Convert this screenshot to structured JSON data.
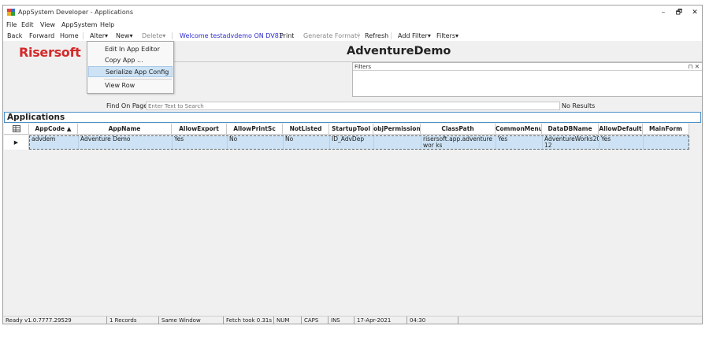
{
  "window": {
    "title": "AppSystem Developer - Applications",
    "minimize": "–",
    "restore": "🗗",
    "close": "✕",
    "app_icon": "app-icon"
  },
  "menu": {
    "file": "File",
    "edit": "Edit",
    "view": "View",
    "appsystem": "AppSystem",
    "help": "Help"
  },
  "toolbar": {
    "back": "Back",
    "forward": "Forward",
    "home": "Home",
    "alter": "Alter▾",
    "new": "New▾",
    "delete": "Delete▾",
    "welcome": "Welcome testadvdemo ON DV81",
    "print": "Print",
    "generate_format": "Generate Format▾",
    "refresh": "Refresh",
    "add_filter": "Add Filter▾",
    "filters": "Filters▾"
  },
  "alter_menu": {
    "items": [
      "Edit In App Editor",
      "Copy App ...",
      "Serialize App Config",
      "View Row"
    ],
    "highlighted": "Serialize App Config"
  },
  "logo": "Risersoft",
  "app_title": "AdventureDemo",
  "filters_panel": {
    "label": "Filters",
    "controls": "⊓ ✕"
  },
  "find": {
    "label": "Find On Page",
    "placeholder": "Enter Text to Search",
    "result": "No Results"
  },
  "section": "Applications",
  "grid": {
    "columns": [
      "AppCode ▲",
      "AppName",
      "AllowExport",
      "AllowPrintSc",
      "NotListed",
      "StartupTool",
      "objPermission",
      "ClassPath",
      "CommonMenu",
      "DataDBName",
      "AllowDefault",
      "MainForm"
    ],
    "rows": [
      {
        "AppCode": "advdem",
        "AppName": "Adventure Demo",
        "AllowExport": "Yes",
        "AllowPrintSc": "No",
        "NotListed": "No",
        "StartupTool": "ID_AdvDep",
        "objPermission": "",
        "ClassPath": "risersoft.app.adventurewor ks",
        "CommonMenu": "Yes",
        "DataDBName": "AdventureWorks20 12",
        "AllowDefault": "Yes",
        "MainForm": ""
      }
    ],
    "row_indicator": "▶"
  },
  "status": {
    "ready": "Ready v1.0.7777.29529",
    "records": "1 Records",
    "window": "Same Window",
    "fetch": "Fetch took 0.31s",
    "num": "NUM",
    "caps": "CAPS",
    "ins": "INS",
    "date": "17-Apr-2021",
    "time": "04:30"
  }
}
